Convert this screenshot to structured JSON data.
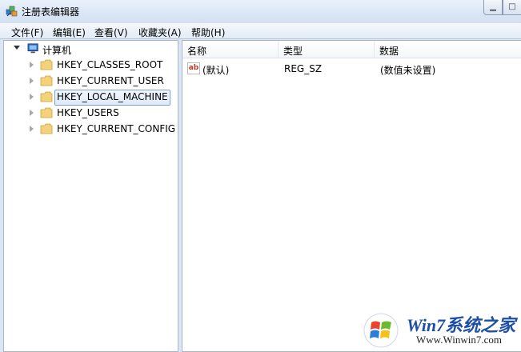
{
  "window": {
    "title": "注册表编辑器",
    "app_icon": "regedit-icon",
    "minimize_glyph": "▁",
    "maximize_glyph": "□"
  },
  "menu": [
    "文件(F)",
    "编辑(E)",
    "查看(V)",
    "收藏夹(A)",
    "帮助(H)"
  ],
  "tree": {
    "root": {
      "label": "计算机",
      "icon": "computer-icon",
      "expanded": true
    },
    "hives": [
      {
        "label": "HKEY_CLASSES_ROOT",
        "selected": false
      },
      {
        "label": "HKEY_CURRENT_USER",
        "selected": false
      },
      {
        "label": "HKEY_LOCAL_MACHINE",
        "selected": true
      },
      {
        "label": "HKEY_USERS",
        "selected": false
      },
      {
        "label": "HKEY_CURRENT_CONFIG",
        "selected": false
      }
    ]
  },
  "list": {
    "columns": [
      "名称",
      "类型",
      "数据"
    ],
    "rows": [
      {
        "icon": "ab",
        "name": "(默认)",
        "type": "REG_SZ",
        "data": "(数值未设置)"
      }
    ]
  },
  "watermark": {
    "title": "Win7系统之家",
    "url": "Www.Winwin7.com"
  },
  "colors": {
    "accent": "#1d4fa7",
    "folder": "#f3d27a",
    "selection_border": "#7da2ce"
  }
}
